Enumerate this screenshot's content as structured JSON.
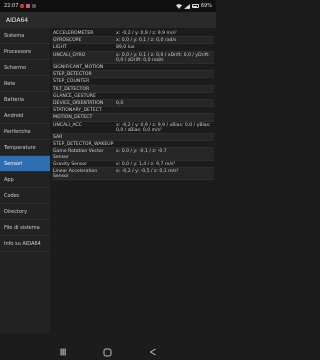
{
  "status": {
    "time": "22:07",
    "battery": "69%"
  },
  "app": {
    "title": "AIDA64"
  },
  "sidebar": {
    "items": [
      {
        "label": "Sistema",
        "active": false
      },
      {
        "label": "Processore",
        "active": false
      },
      {
        "label": "Schermo",
        "active": false
      },
      {
        "label": "Rete",
        "active": false
      },
      {
        "label": "Batteria",
        "active": false
      },
      {
        "label": "Android",
        "active": false
      },
      {
        "label": "Periferiche",
        "active": false
      },
      {
        "label": "Temperature",
        "active": false
      },
      {
        "label": "Sensori",
        "active": true
      },
      {
        "label": "App",
        "active": false
      },
      {
        "label": "Codec",
        "active": false
      },
      {
        "label": "Directory",
        "active": false
      },
      {
        "label": "File di sistema",
        "active": false
      },
      {
        "label": "Info su AIDA64",
        "active": false
      }
    ]
  },
  "sensors": [
    {
      "name": "ACCELEROMETER",
      "value": "x: -0,2 / y: 0,9 / z: 9,9 m/s²"
    },
    {
      "name": "GYROSCOPE",
      "value": "x: 0,0 / y: 0,1 / z: 0,0 rad/s"
    },
    {
      "name": "LIGHT",
      "value": "89,0 lux"
    },
    {
      "name": "UNCALI_GYRO",
      "value": "x: 0,0 / y: 0,1 / z: 0,0 / xDrift: 0,0 / yDrift: 0,0 / zDrift: 0,0 rad/s"
    },
    {
      "name": "SIGNIFICANT_MOTION",
      "value": ""
    },
    {
      "name": "STEP_DETECTOR",
      "value": ""
    },
    {
      "name": "STEP_COUNTER",
      "value": ""
    },
    {
      "name": "TILT_DETECTOR",
      "value": ""
    },
    {
      "name": "GLANCE_GESTURE",
      "value": ""
    },
    {
      "name": "DEVICE_ORIENTATION",
      "value": "0,0"
    },
    {
      "name": "STATIONARY_DETECT",
      "value": ""
    },
    {
      "name": "MOTION_DETECT",
      "value": ""
    },
    {
      "name": "UNCALI_ACC",
      "value": "x: -0,2 / y: 0,9 / z: 9,9 / xBias: 0,0 / yBias: 0,0 / zBias: 0,0 m/s²"
    },
    {
      "name": "SAR",
      "value": ""
    },
    {
      "name": "STEP_DETECTOR_WAKEUP",
      "value": ""
    },
    {
      "name": "Game Rotation Vector Sensor",
      "value": "x: 0,0 / y: -0,1 / z: -0,7"
    },
    {
      "name": "Gravity Sensor",
      "value": "x: 0,0 / y: 1,4 / z: 9,7 m/s²"
    },
    {
      "name": "Linear Acceleration Sensor",
      "value": "x: -0,2 / y: -0,5 / z: 0,1 m/s²"
    }
  ],
  "icons": {
    "nav_home": "circle-home-icon",
    "nav_back": "triangle-back-icon",
    "nav_recents": "recents-icon"
  }
}
